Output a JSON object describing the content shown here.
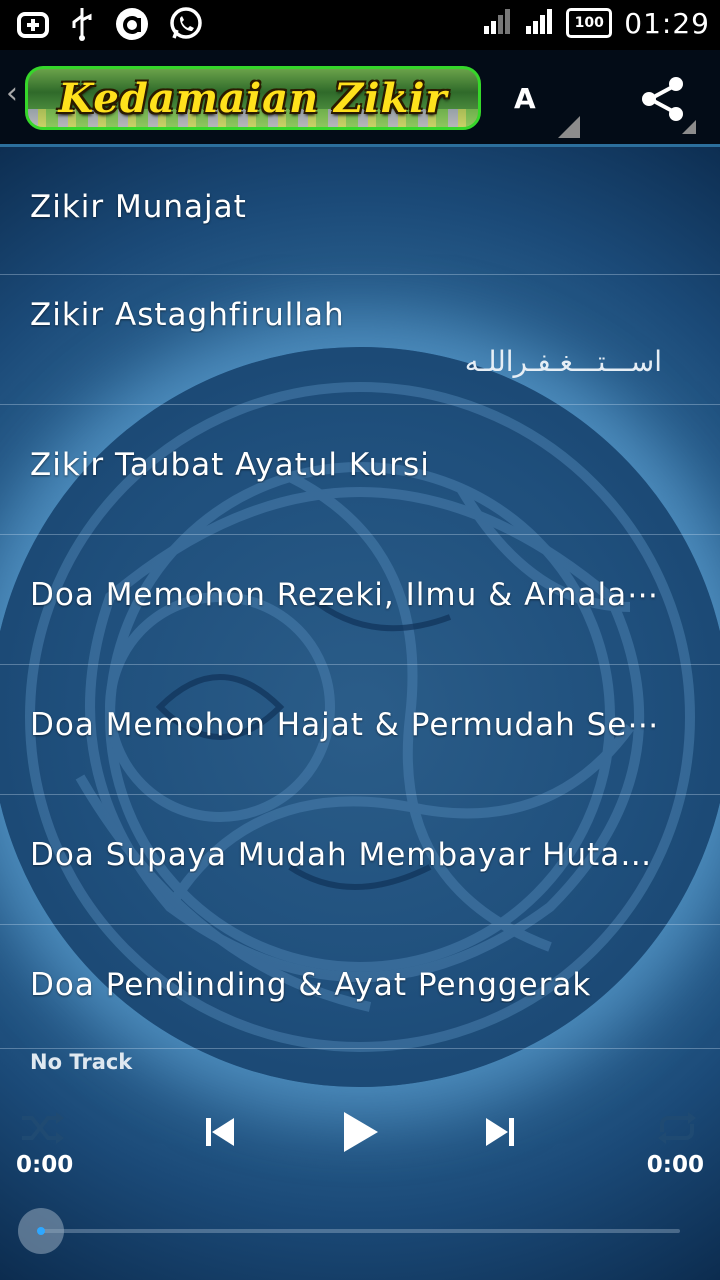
{
  "status_bar": {
    "time": "01:29",
    "battery": "100",
    "left_icons": [
      "add-notification-icon",
      "usb-icon",
      "app-a-icon",
      "whatsapp-icon"
    ],
    "right_icons": [
      "signal-1-icon",
      "signal-2-icon",
      "battery-icon"
    ]
  },
  "action_bar": {
    "back": "‹",
    "logo_text": "Kedamaian Zikir",
    "font_button": "A",
    "share_icon": "share-icon"
  },
  "list": {
    "items": [
      {
        "title": "Zikir Munajat"
      },
      {
        "title": "Zikir Astaghfirullah",
        "arabic": "اســـتـــغـفـراللـه"
      },
      {
        "title": "Zikir Taubat Ayatul Kursi"
      },
      {
        "title": "Doa Memohon Rezeki, Ilmu & Amala⋯"
      },
      {
        "title": "Doa Memohon Hajat & Permudah Se⋯"
      },
      {
        "title": "Doa Supaya Mudah Membayar Hutang"
      },
      {
        "title": "Doa Pendinding & Ayat Penggerak"
      }
    ]
  },
  "player": {
    "track": "No Track",
    "elapsed": "0:00",
    "duration": "0:00",
    "progress": 0,
    "controls": [
      "shuffle-icon",
      "previous-icon",
      "play-icon",
      "next-icon",
      "repeat-icon"
    ]
  },
  "colors": {
    "logo_border": "#36d72a",
    "logo_text": "#ffe11c",
    "divider": "#2c6f9c",
    "seek_dot": "#2ea7ff"
  }
}
